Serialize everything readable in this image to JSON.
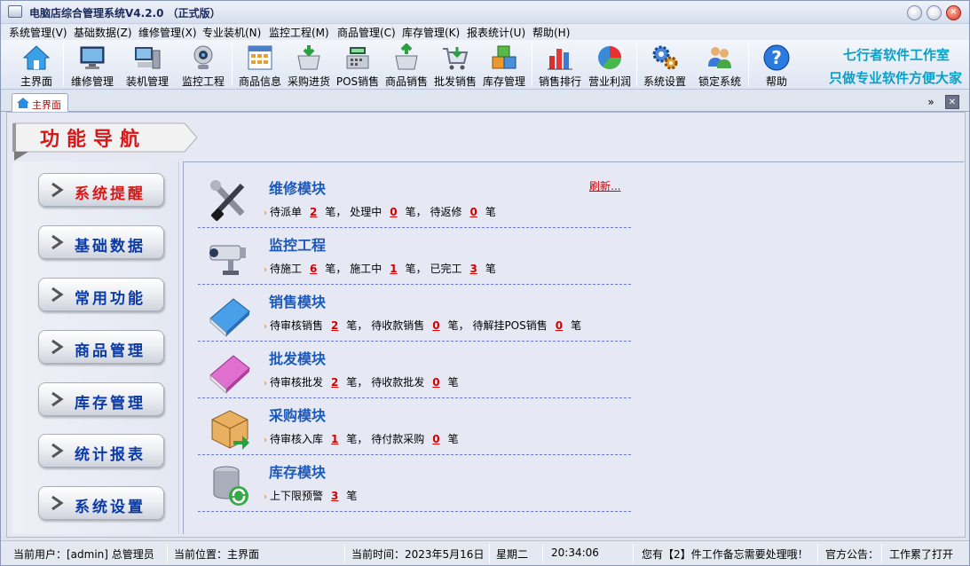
{
  "window": {
    "title": "电脑店综合管理系统V4.2.0 （正式版）"
  },
  "menu": [
    "系统管理(V)",
    "基础数据(Z)",
    "维修管理(X)",
    "专业装机(N)",
    "监控工程(M)",
    "商品管理(C)",
    "库存管理(K)",
    "报表统计(U)",
    "帮助(H)"
  ],
  "toolbar": {
    "items": [
      {
        "label": "主界面",
        "icon": "home-icon"
      },
      {
        "label": "维修管理",
        "icon": "monitor-icon"
      },
      {
        "label": "装机管理",
        "icon": "computer-icon"
      },
      {
        "label": "监控工程",
        "icon": "webcam-icon"
      },
      {
        "label": "商品信息",
        "icon": "grid-icon"
      },
      {
        "label": "采购进货",
        "icon": "basket-in-icon"
      },
      {
        "label": "POS销售",
        "icon": "pos-register-icon"
      },
      {
        "label": "商品销售",
        "icon": "basket-out-icon"
      },
      {
        "label": "批发销售",
        "icon": "cart-icon"
      },
      {
        "label": "库存管理",
        "icon": "boxes-icon"
      },
      {
        "label": "销售排行",
        "icon": "bar-chart-icon"
      },
      {
        "label": "营业利润",
        "icon": "pie-chart-icon"
      },
      {
        "label": "系统设置",
        "icon": "gears-icon"
      },
      {
        "label": "锁定系统",
        "icon": "users-lock-icon"
      },
      {
        "label": "帮助",
        "icon": "help-icon"
      }
    ],
    "slogan_line1": "七行者软件工作室",
    "slogan_line2": "只做专业软件方便大家"
  },
  "tab": {
    "label": "主界面"
  },
  "banner": {
    "text": "功能导航"
  },
  "nav": [
    "系统提醒",
    "基础数据",
    "常用功能",
    "商品管理",
    "库存管理",
    "统计报表",
    "系统设置"
  ],
  "refresh_label": "刷新...",
  "modules": [
    {
      "title": "维修模块",
      "icon": "tools-icon",
      "items": [
        {
          "label": "待派单",
          "value": "2",
          "unit": "笔，"
        },
        {
          "label": "处理中",
          "value": "0",
          "unit": "笔，"
        },
        {
          "label": "待返修",
          "value": "0",
          "unit": "笔"
        }
      ]
    },
    {
      "title": "监控工程",
      "icon": "cctv-camera-icon",
      "items": [
        {
          "label": "待施工",
          "value": "6",
          "unit": "笔，"
        },
        {
          "label": "施工中",
          "value": "1",
          "unit": "笔，"
        },
        {
          "label": "已完工",
          "value": "3",
          "unit": "笔"
        }
      ]
    },
    {
      "title": "销售模块",
      "icon": "blue-book-icon",
      "items": [
        {
          "label": "待审核销售",
          "value": "2",
          "unit": "笔，"
        },
        {
          "label": "待收款销售",
          "value": "0",
          "unit": "笔，"
        },
        {
          "label": "待解挂POS销售",
          "value": "0",
          "unit": "笔"
        }
      ]
    },
    {
      "title": "批发模块",
      "icon": "pink-book-icon",
      "items": [
        {
          "label": "待审核批发",
          "value": "2",
          "unit": "笔，"
        },
        {
          "label": "待收款批发",
          "value": "0",
          "unit": "笔"
        }
      ]
    },
    {
      "title": "采购模块",
      "icon": "package-in-icon",
      "items": [
        {
          "label": "待审核入库",
          "value": "1",
          "unit": "笔，"
        },
        {
          "label": "待付款采购",
          "value": "0",
          "unit": "笔"
        }
      ]
    },
    {
      "title": "库存模块",
      "icon": "database-refresh-icon",
      "items": [
        {
          "label": "上下限预警",
          "value": "3",
          "unit": "笔"
        }
      ]
    }
  ],
  "status": {
    "user": "当前用户：[admin] 总管理员",
    "location": "当前位置：主界面",
    "time_label": "当前时间：2023年5月16日",
    "weekday": "星期二",
    "clock": "20:34:06",
    "memo": "您有【2】件工作备忘需要处理哦！",
    "notice_label": "官方公告：",
    "notice_text": "工作累了打开"
  },
  "colors": {
    "accent_blue": "#1b58b8",
    "alert_red": "#d40000",
    "nav_text": "#0a3aa8",
    "banner_red": "#d81818"
  }
}
